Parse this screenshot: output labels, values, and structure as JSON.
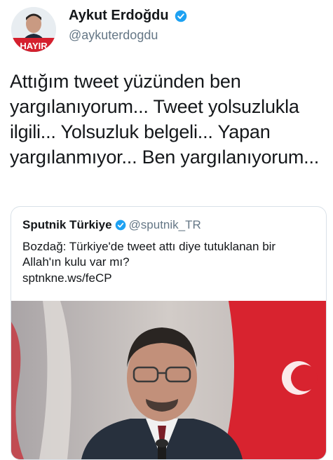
{
  "author": {
    "display_name": "Aykut Erdoğdu",
    "handle": "@aykuterdogdu",
    "avatar_badge": "HAYIR"
  },
  "tweet": {
    "text": "Attığım tweet yüzünden ben yargılanıyorum... Tweet yolsuzlukla ilgili... Yolsuzluk belgeli... Yapan yargılanmıyor... Ben yargılanıyorum..."
  },
  "quoted": {
    "display_name": "Sputnik Türkiye",
    "handle": "@sputnik_TR",
    "text": "Bozdağ: Türkiye'de tweet attı diye tutuklanan bir Allah'ın kulu var mı?",
    "link": "sptnkne.ws/feCP"
  },
  "icons": {
    "verified": "verified-badge-icon",
    "flag": "turkish-flag"
  },
  "colors": {
    "verified": "#1da1f2",
    "text": "#14171a",
    "secondary": "#657786",
    "flag_red": "#d8232f"
  }
}
